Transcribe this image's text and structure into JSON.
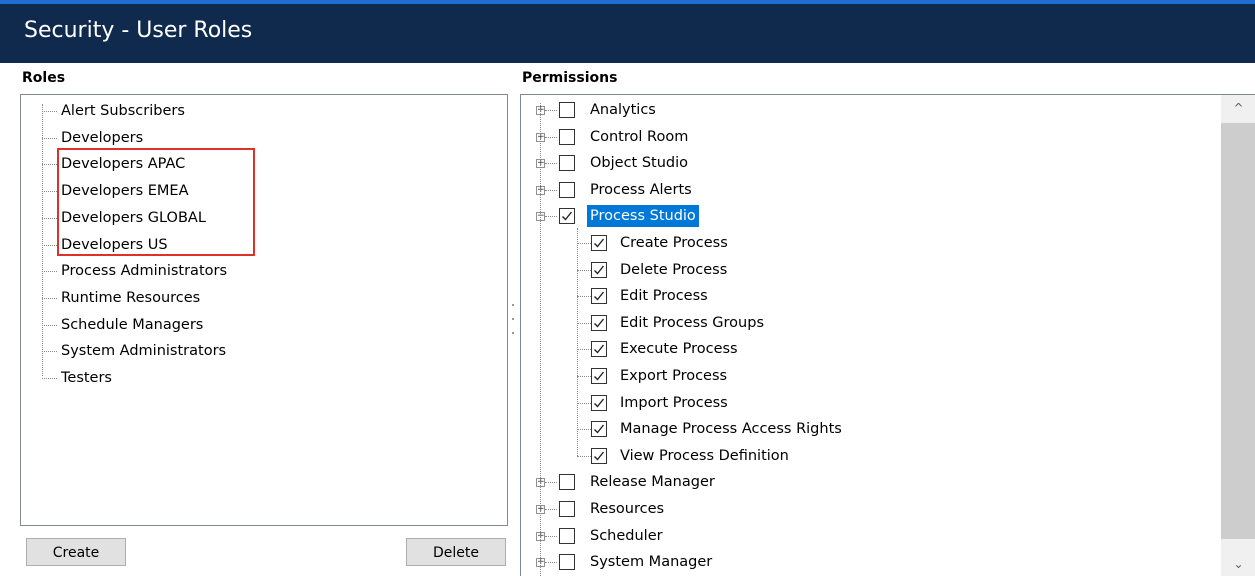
{
  "window": {
    "title": "Security - User Roles"
  },
  "roles": {
    "label": "Roles",
    "items": [
      "Alert Subscribers",
      "Developers",
      "Developers APAC",
      "Developers EMEA",
      "Developers GLOBAL",
      "Developers US",
      "Process Administrators",
      "Runtime Resources",
      "Schedule Managers",
      "System Administrators",
      "Testers"
    ],
    "create_label": "Create",
    "delete_label": "Delete"
  },
  "permissions": {
    "label": "Permissions",
    "top_items": [
      {
        "label": "Analytics",
        "checked": false,
        "expanded": false
      },
      {
        "label": "Control Room",
        "checked": false,
        "expanded": false
      },
      {
        "label": "Object Studio",
        "checked": false,
        "expanded": false
      },
      {
        "label": "Process Alerts",
        "checked": false,
        "expanded": false
      },
      {
        "label": "Process Studio",
        "checked": true,
        "expanded": true,
        "selected": true
      },
      {
        "label": "Release Manager",
        "checked": false,
        "expanded": false
      },
      {
        "label": "Resources",
        "checked": false,
        "expanded": false
      },
      {
        "label": "Scheduler",
        "checked": false,
        "expanded": false
      },
      {
        "label": "System Manager",
        "checked": false,
        "expanded": false
      }
    ],
    "process_studio_children": [
      "Create Process",
      "Delete Process",
      "Edit Process",
      "Edit Process Groups",
      "Execute Process",
      "Export Process",
      "Import Process",
      "Manage Process Access Rights",
      "View Process Definition"
    ]
  },
  "scrollbar": {
    "up_arrow": "^",
    "down_arrow": "⌄"
  },
  "colors": {
    "titlebar": "#0f2a4c",
    "accent": "#1e6fd0",
    "selection": "#0078d7",
    "highlight_box": "#e0302a"
  }
}
